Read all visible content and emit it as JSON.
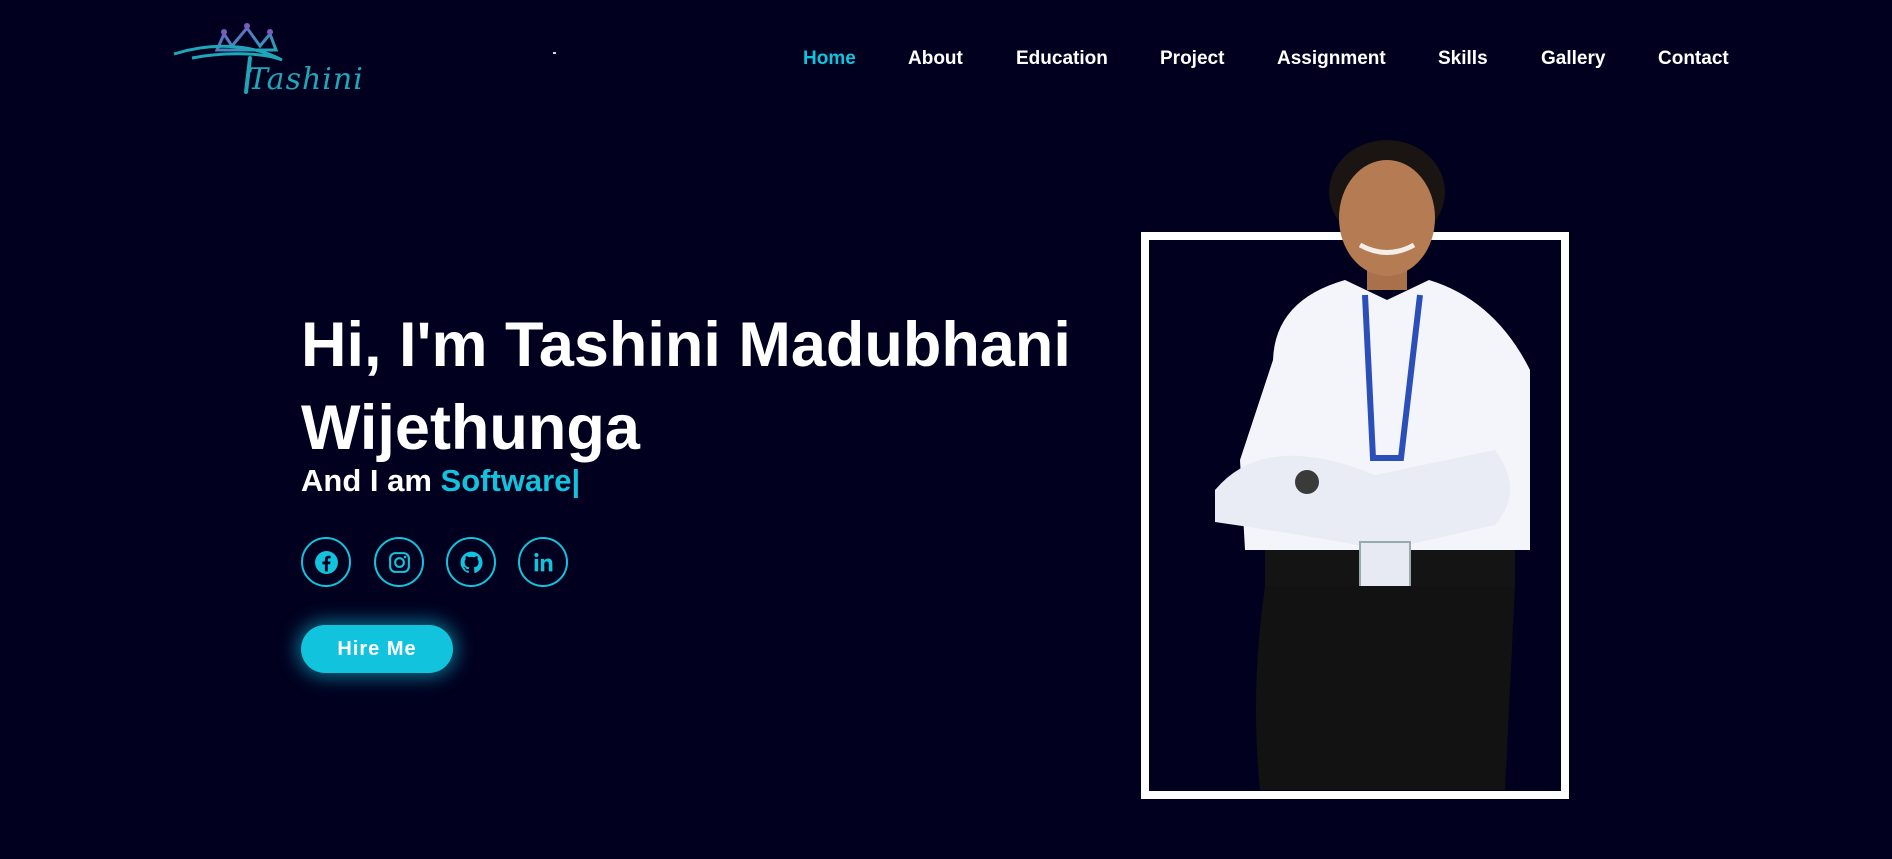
{
  "header": {
    "logo_text": "Tashini",
    "nav": [
      {
        "label": "Home",
        "active": true
      },
      {
        "label": "About",
        "active": false
      },
      {
        "label": "Education",
        "active": false
      },
      {
        "label": "Project",
        "active": false
      },
      {
        "label": "Assignment",
        "active": false
      },
      {
        "label": "Skills",
        "active": false
      },
      {
        "label": "Gallery",
        "active": false
      },
      {
        "label": "Contact",
        "active": false
      }
    ]
  },
  "hero": {
    "title": "Hi, I'm Tashini Madubhani Wijethunga",
    "subtitle_prefix": "And I am",
    "subtitle_role": "Software|",
    "socials": [
      {
        "icon": "facebook-icon"
      },
      {
        "icon": "instagram-icon"
      },
      {
        "icon": "github-icon"
      },
      {
        "icon": "linkedin-icon"
      }
    ],
    "cta_label": "Hire Me"
  },
  "colors": {
    "background": "#01011f",
    "accent": "#12c3de",
    "text": "#ffffff"
  }
}
